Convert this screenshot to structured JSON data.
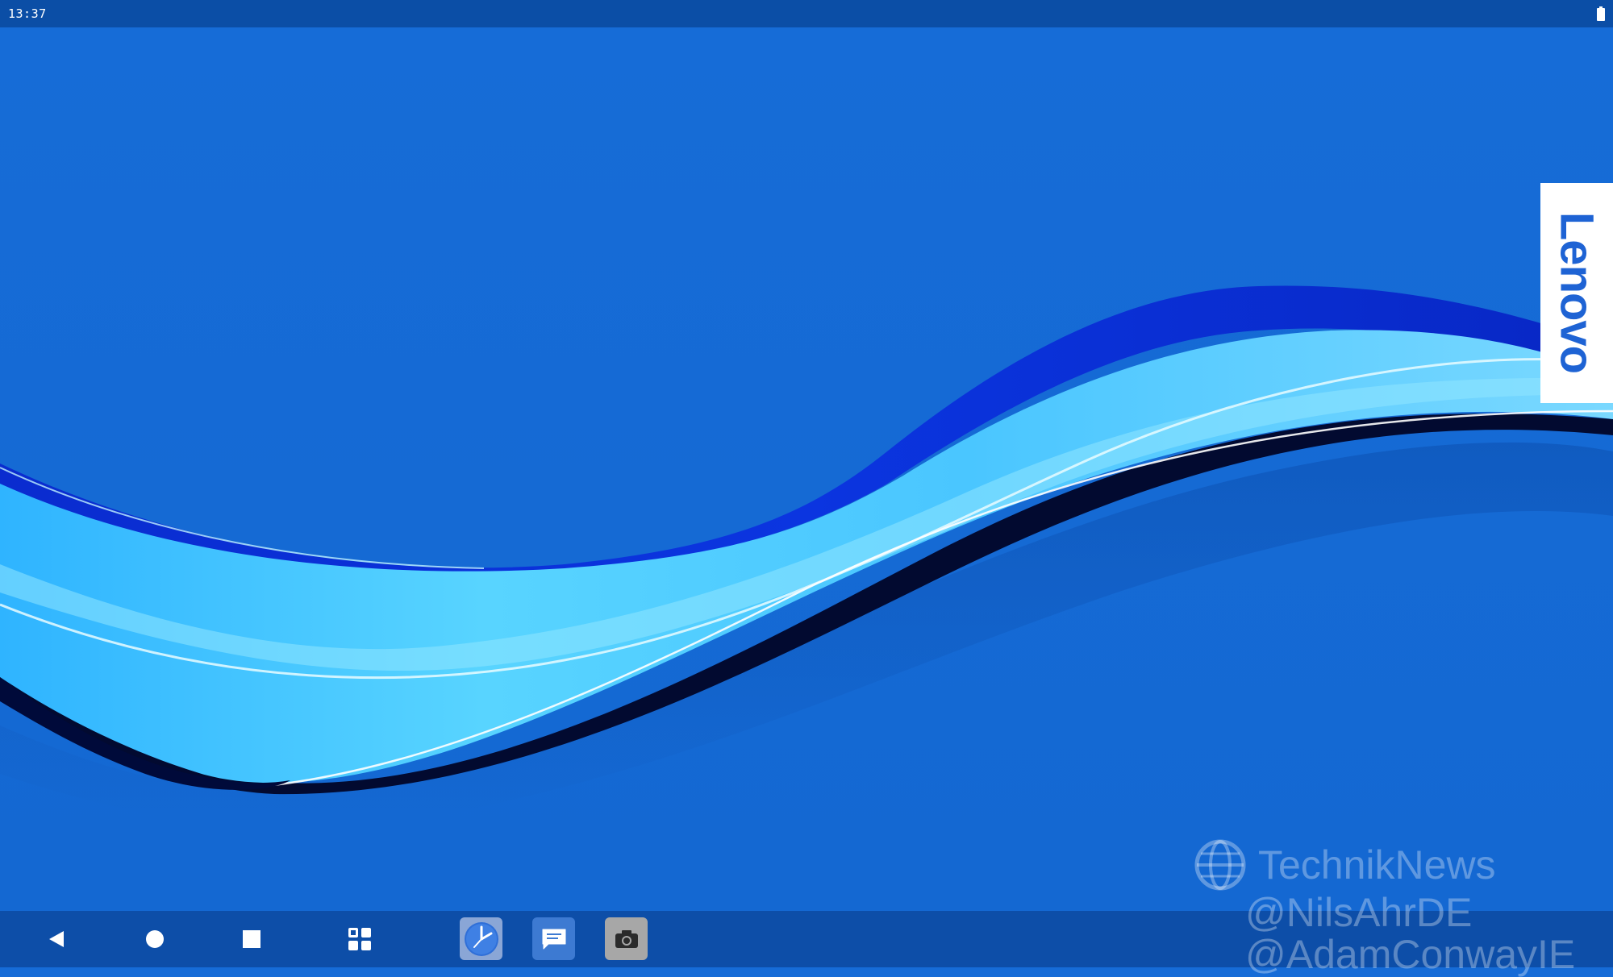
{
  "status_bar": {
    "time": "13:37",
    "battery_icon": "battery-full-icon"
  },
  "wallpaper": {
    "brand_logo_text": "Lenovo",
    "background_color": "#166cd7",
    "wave_colors": [
      "#5ad6ff",
      "#2aa5f5",
      "#0a2ccf",
      "#000a3a"
    ]
  },
  "watermark": {
    "icon": "globe-icon",
    "title": "TechnikNews",
    "handles": [
      "@NilsAhrDE",
      "@AdamConwayIE"
    ]
  },
  "nav_bar": {
    "buttons": [
      {
        "name": "back",
        "icon": "back-triangle-icon"
      },
      {
        "name": "home",
        "icon": "home-circle-icon"
      },
      {
        "name": "recents",
        "icon": "recents-square-icon"
      },
      {
        "name": "app-drawer",
        "icon": "app-grid-icon"
      }
    ],
    "dock_apps": [
      {
        "name": "clock",
        "icon": "clock-icon",
        "color": "#8aa6d6"
      },
      {
        "name": "messages",
        "icon": "messages-icon",
        "color": "#3d7ad2"
      },
      {
        "name": "camera",
        "icon": "camera-icon",
        "color": "#a7a7a7"
      }
    ]
  }
}
